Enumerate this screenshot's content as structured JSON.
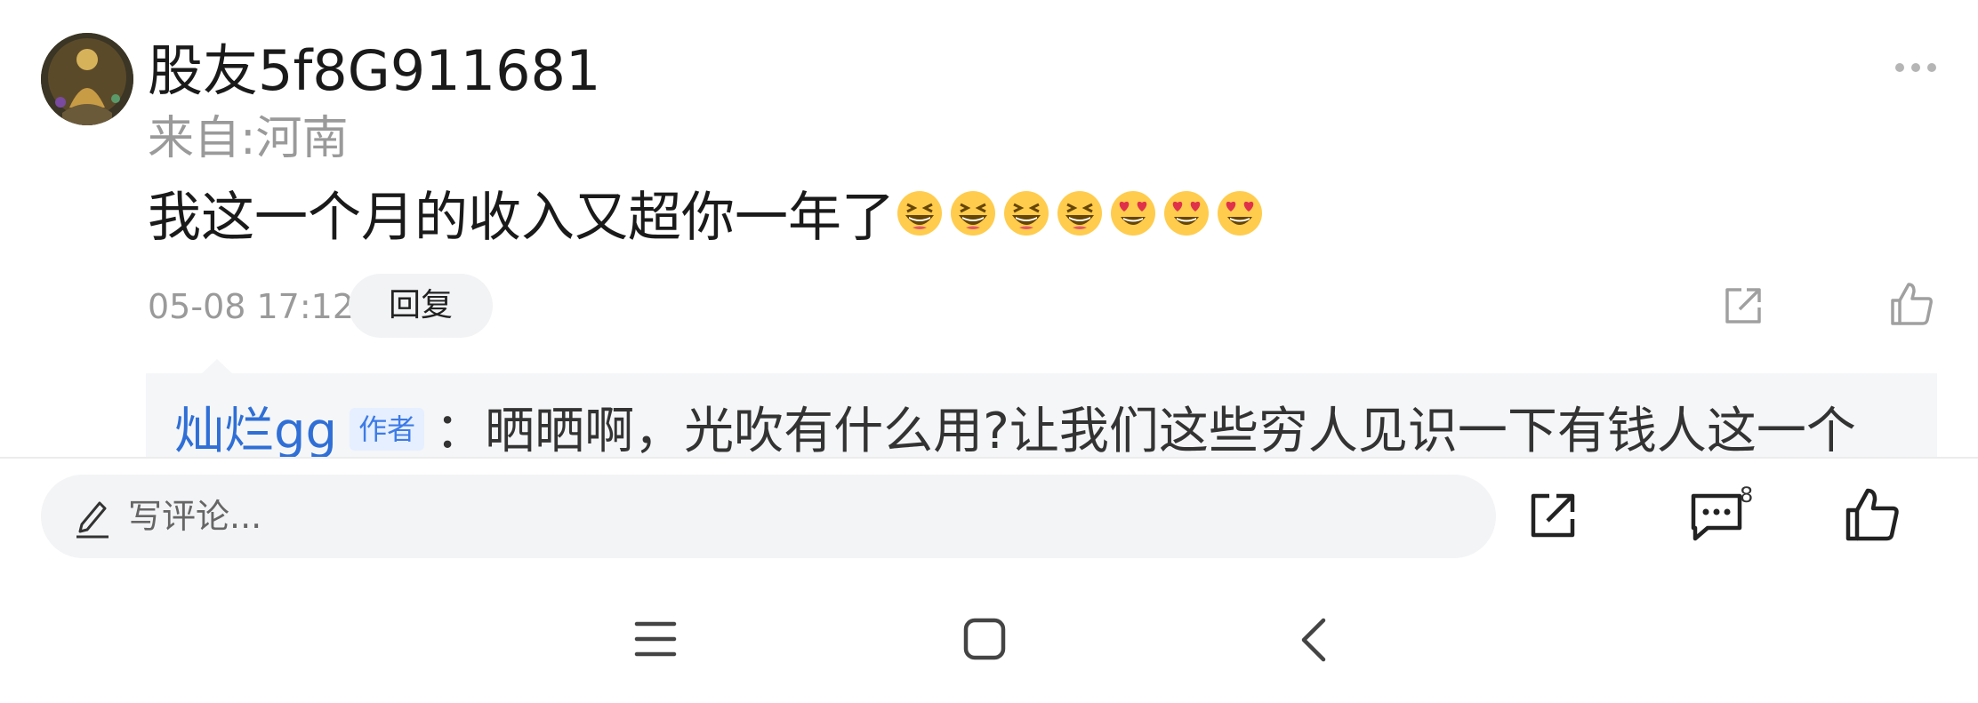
{
  "comment": {
    "username": "股友5f8G911681",
    "location": "来自:河南",
    "text": "我这一个月的收入又超你一年了",
    "emojis": [
      "grinning-squinting-face",
      "grinning-squinting-face",
      "grinning-squinting-face",
      "grinning-squinting-face",
      "heart-eyes-face",
      "heart-eyes-face",
      "heart-eyes-face"
    ],
    "timestamp": "05-08 17:12",
    "reply_label": "回复"
  },
  "reply": {
    "author": "灿烂gg",
    "author_badge": "作者",
    "text": "：晒晒啊，光吹有什么用?让我们这些穷人见识一下有钱人这一个"
  },
  "bottom_bar": {
    "input_placeholder": "写评论...",
    "comment_count": "8"
  },
  "colors": {
    "link_blue": "#2f6fd6",
    "badge_bg": "#e6efff",
    "muted_gray": "#9a9a9a"
  }
}
